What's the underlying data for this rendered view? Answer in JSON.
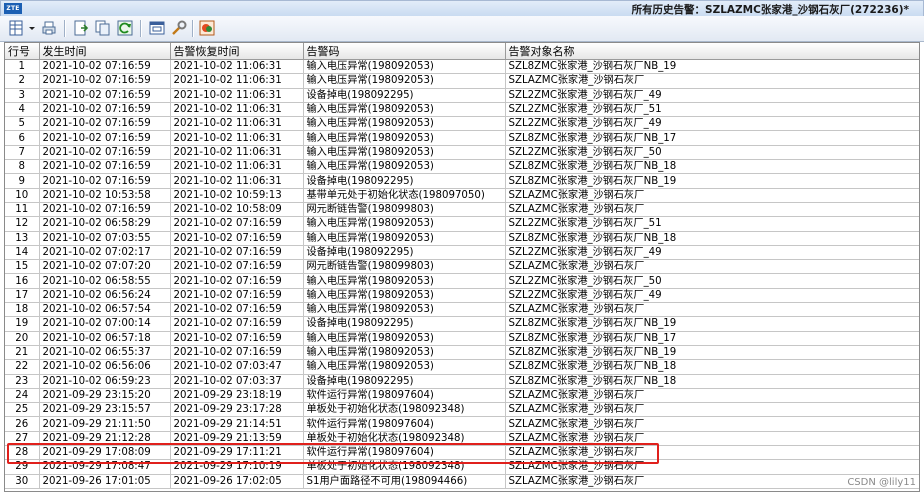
{
  "window": {
    "logo": "ZTE",
    "title": "所有历史告警：SZLAZMC张家港_沙钢石灰厂(272236)*"
  },
  "toolbar": {
    "icons": [
      "table-view-icon",
      "dropdown-arrow-icon",
      "print-icon",
      "export-icon",
      "copy-icon",
      "refresh-icon",
      "window-icon",
      "settings-wrench-icon",
      "locate-icon"
    ]
  },
  "columns": [
    "行号",
    "发生时间",
    "告警恢复时间",
    "告警码",
    "告警对象名称"
  ],
  "rows": [
    [
      "1",
      "2021-10-02 07:16:59",
      "2021-10-02 11:06:31",
      "输入电压异常(198092053)",
      "SZL8ZMC张家港_沙钢石灰厂NB_19"
    ],
    [
      "2",
      "2021-10-02 07:16:59",
      "2021-10-02 11:06:31",
      "输入电压异常(198092053)",
      "SZLAZMC张家港_沙钢石灰厂"
    ],
    [
      "3",
      "2021-10-02 07:16:59",
      "2021-10-02 11:06:31",
      "设备掉电(198092295)",
      "SZL2ZMC张家港_沙钢石灰厂_49"
    ],
    [
      "4",
      "2021-10-02 07:16:59",
      "2021-10-02 11:06:31",
      "输入电压异常(198092053)",
      "SZL2ZMC张家港_沙钢石灰厂_51"
    ],
    [
      "5",
      "2021-10-02 07:16:59",
      "2021-10-02 11:06:31",
      "输入电压异常(198092053)",
      "SZL2ZMC张家港_沙钢石灰厂_49"
    ],
    [
      "6",
      "2021-10-02 07:16:59",
      "2021-10-02 11:06:31",
      "输入电压异常(198092053)",
      "SZL8ZMC张家港_沙钢石灰厂NB_17"
    ],
    [
      "7",
      "2021-10-02 07:16:59",
      "2021-10-02 11:06:31",
      "输入电压异常(198092053)",
      "SZL2ZMC张家港_沙钢石灰厂_50"
    ],
    [
      "8",
      "2021-10-02 07:16:59",
      "2021-10-02 11:06:31",
      "输入电压异常(198092053)",
      "SZL8ZMC张家港_沙钢石灰厂NB_18"
    ],
    [
      "9",
      "2021-10-02 07:16:59",
      "2021-10-02 11:06:31",
      "设备掉电(198092295)",
      "SZL8ZMC张家港_沙钢石灰厂NB_19"
    ],
    [
      "10",
      "2021-10-02 10:53:58",
      "2021-10-02 10:59:13",
      "基带单元处于初始化状态(198097050)",
      "SZLAZMC张家港_沙钢石灰厂"
    ],
    [
      "11",
      "2021-10-02 07:16:59",
      "2021-10-02 10:58:09",
      "网元断链告警(198099803)",
      "SZLAZMC张家港_沙钢石灰厂"
    ],
    [
      "12",
      "2021-10-02 06:58:29",
      "2021-10-02 07:16:59",
      "输入电压异常(198092053)",
      "SZL2ZMC张家港_沙钢石灰厂_51"
    ],
    [
      "13",
      "2021-10-02 07:03:55",
      "2021-10-02 07:16:59",
      "输入电压异常(198092053)",
      "SZL8ZMC张家港_沙钢石灰厂NB_18"
    ],
    [
      "14",
      "2021-10-02 07:02:17",
      "2021-10-02 07:16:59",
      "设备掉电(198092295)",
      "SZL2ZMC张家港_沙钢石灰厂_49"
    ],
    [
      "15",
      "2021-10-02 07:07:20",
      "2021-10-02 07:16:59",
      "网元断链告警(198099803)",
      "SZLAZMC张家港_沙钢石灰厂"
    ],
    [
      "16",
      "2021-10-02 06:58:55",
      "2021-10-02 07:16:59",
      "输入电压异常(198092053)",
      "SZL2ZMC张家港_沙钢石灰厂_50"
    ],
    [
      "17",
      "2021-10-02 06:56:24",
      "2021-10-02 07:16:59",
      "输入电压异常(198092053)",
      "SZL2ZMC张家港_沙钢石灰厂_49"
    ],
    [
      "18",
      "2021-10-02 06:57:54",
      "2021-10-02 07:16:59",
      "输入电压异常(198092053)",
      "SZLAZMC张家港_沙钢石灰厂"
    ],
    [
      "19",
      "2021-10-02 07:00:14",
      "2021-10-02 07:16:59",
      "设备掉电(198092295)",
      "SZL8ZMC张家港_沙钢石灰厂NB_19"
    ],
    [
      "20",
      "2021-10-02 06:57:18",
      "2021-10-02 07:16:59",
      "输入电压异常(198092053)",
      "SZL8ZMC张家港_沙钢石灰厂NB_17"
    ],
    [
      "21",
      "2021-10-02 06:55:37",
      "2021-10-02 07:16:59",
      "输入电压异常(198092053)",
      "SZL8ZMC张家港_沙钢石灰厂NB_19"
    ],
    [
      "22",
      "2021-10-02 06:56:06",
      "2021-10-02 07:03:47",
      "输入电压异常(198092053)",
      "SZL8ZMC张家港_沙钢石灰厂NB_18"
    ],
    [
      "23",
      "2021-10-02 06:59:23",
      "2021-10-02 07:03:37",
      "设备掉电(198092295)",
      "SZL8ZMC张家港_沙钢石灰厂NB_18"
    ],
    [
      "24",
      "2021-09-29 23:15:20",
      "2021-09-29 23:18:19",
      "软件运行异常(198097604)",
      "SZLAZMC张家港_沙钢石灰厂"
    ],
    [
      "25",
      "2021-09-29 23:15:57",
      "2021-09-29 23:17:28",
      "单板处于初始化状态(198092348)",
      "SZLAZMC张家港_沙钢石灰厂"
    ],
    [
      "26",
      "2021-09-29 21:11:50",
      "2021-09-29 21:14:51",
      "软件运行异常(198097604)",
      "SZLAZMC张家港_沙钢石灰厂"
    ],
    [
      "27",
      "2021-09-29 21:12:28",
      "2021-09-29 21:13:59",
      "单板处于初始化状态(198092348)",
      "SZLAZMC张家港_沙钢石灰厂"
    ],
    [
      "28",
      "2021-09-29 17:08:09",
      "2021-09-29 17:11:21",
      "软件运行异常(198097604)",
      "SZLAZMC张家港_沙钢石灰厂"
    ],
    [
      "29",
      "2021-09-29 17:08:47",
      "2021-09-29 17:10:19",
      "单板处于初始化状态(198092348)",
      "SZLAZMC张家港_沙钢石灰厂"
    ],
    [
      "30",
      "2021-09-26 17:01:05",
      "2021-09-26 17:02:05",
      "S1用户面路径不可用(198094466)",
      "SZLAZMC张家港_沙钢石灰厂"
    ]
  ],
  "watermark": "CSDN @lily11",
  "colors": {
    "highlight": "#e0201c",
    "header_bg": "#e6e6e6",
    "titlebar": "#c9dbf1"
  }
}
